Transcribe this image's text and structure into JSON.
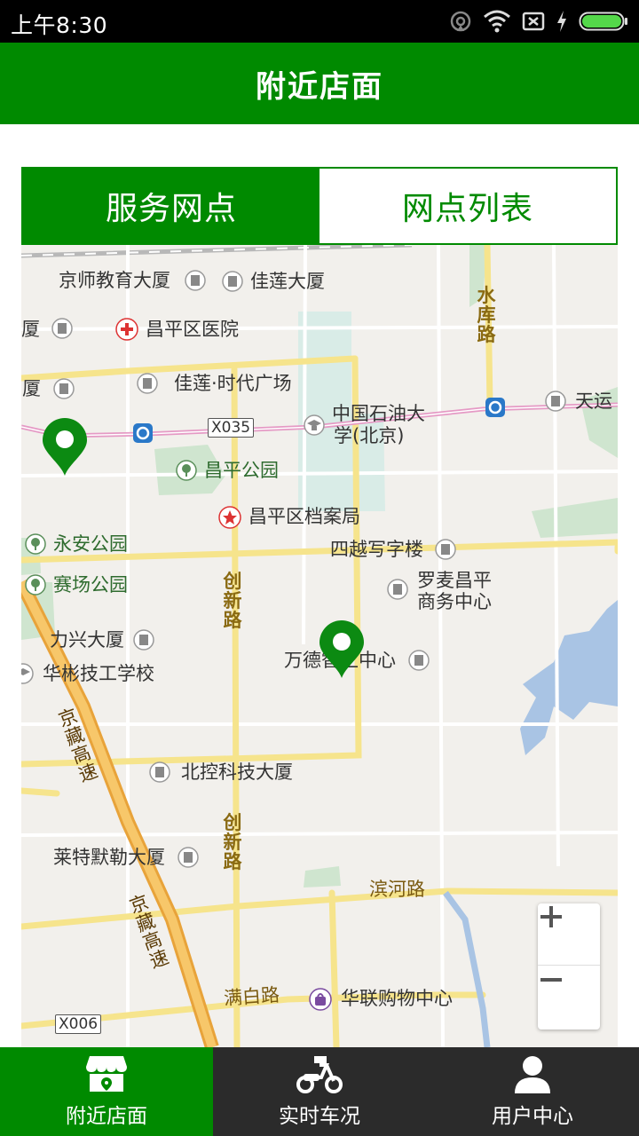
{
  "status_bar": {
    "time": "上午8:30"
  },
  "header": {
    "title": "附近店面"
  },
  "tabs": [
    {
      "label": "服务网点",
      "active": true
    },
    {
      "label": "网点列表",
      "active": false
    }
  ],
  "map": {
    "pois": {
      "jingshi": "京师教育大厦",
      "jialian_building": "佳莲大厦",
      "xia1": "厦",
      "hospital": "昌平区医院",
      "xia2": "大厦",
      "jialian_plaza": "佳莲·时代广场",
      "petroleum_l1": "中国石油大",
      "petroleum_l2": "学(北京)",
      "tianyun": "天运",
      "park": "昌平公园",
      "archives": "昌平区档案局",
      "yongan": "永安公园",
      "siyue": "四越写字楼",
      "saichang": "赛场公园",
      "luomai_l1": "罗麦昌平",
      "luomai_l2": "商务中心",
      "lixing": "力兴大厦",
      "wande": "万德智汇中心",
      "huabin": "华彬技工学校",
      "beikong": "北控科技大厦",
      "laite": "莱特默勒大厦",
      "hualian": "华联购物中心"
    },
    "roads": {
      "shuiku": "水库路",
      "chuangxin1": "创新路",
      "chuangxin2": "创新路",
      "binhe": "滨河路",
      "manbai": "满白路",
      "jingzang1": "京藏高速",
      "jingzang2": "京藏高速"
    },
    "tags": {
      "x035": "X035",
      "x006": "X006"
    },
    "zoom_in_label": "+",
    "zoom_out_label": "−"
  },
  "bottom_nav": [
    {
      "label": "附近店面",
      "icon": "store-icon",
      "active": true
    },
    {
      "label": "实时车况",
      "icon": "scooter-icon",
      "active": false
    },
    {
      "label": "用户中心",
      "icon": "user-icon",
      "active": false
    }
  ],
  "colors": {
    "primary": "#008a00",
    "nav_bg": "#2b2b2b"
  }
}
